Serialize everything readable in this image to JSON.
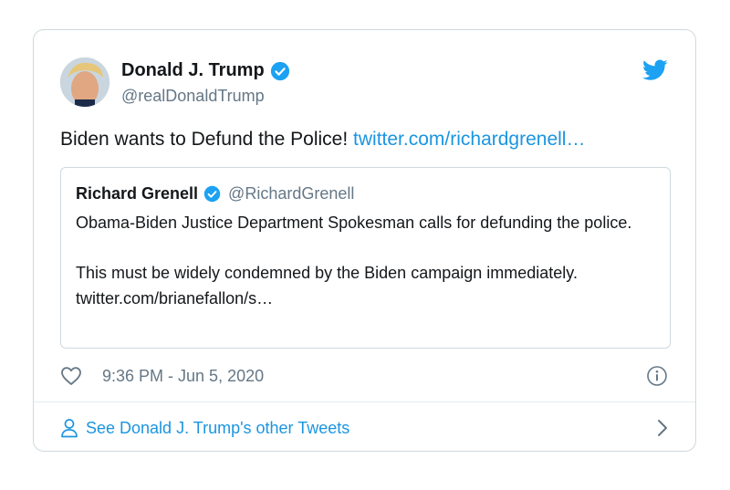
{
  "author": {
    "name": "Donald J. Trump",
    "handle": "@realDonaldTrump",
    "verified_icon": "verified-badge-icon"
  },
  "tweet": {
    "text": "Biden wants to Defund the Police!",
    "link": "twitter.com/richardgrenell…"
  },
  "quoted_tweet": {
    "author_name": "Richard Grenell",
    "author_handle": "@RichardGrenell",
    "paragraph1": "Obama-Biden Justice Department Spokesman calls for defunding the police.",
    "paragraph2": "This must be widely condemned by the Biden campaign immediately. twitter.com/brianefallon/s…"
  },
  "meta": {
    "timestamp": "9:36 PM - Jun 5, 2020"
  },
  "footer": {
    "label": "See Donald J. Trump's other Tweets"
  },
  "colors": {
    "link": "#1b95e0",
    "muted": "#657786",
    "border": "#cfd9de",
    "text": "#14171a"
  }
}
